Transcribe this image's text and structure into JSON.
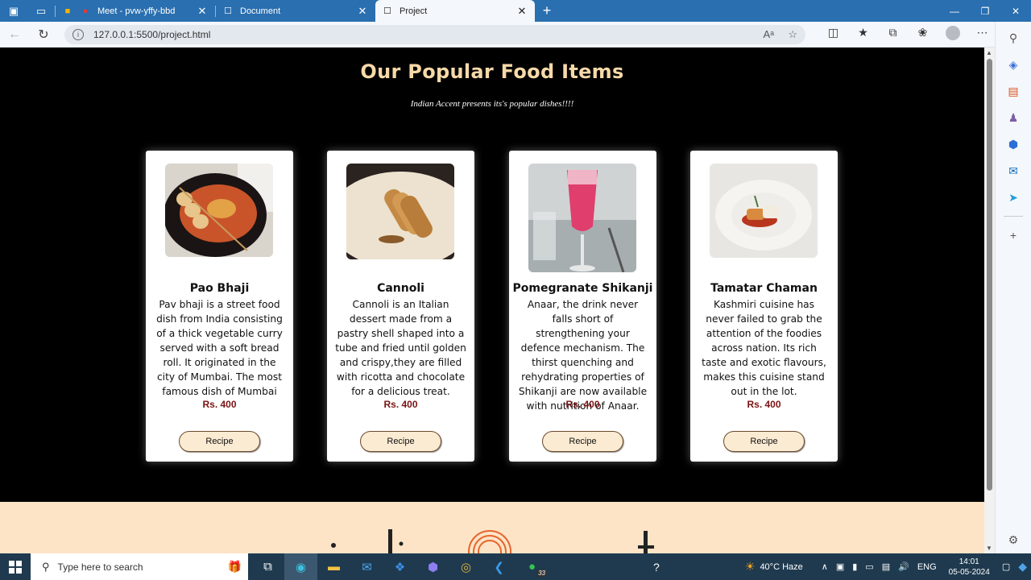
{
  "browser": {
    "tabs": [
      {
        "title": "Meet - pvw-yffy-bbd",
        "active": false
      },
      {
        "title": "Document",
        "active": false
      },
      {
        "title": "Project",
        "active": true
      }
    ],
    "url": "127.0.0.1:5500/project.html",
    "window_controls": [
      "—",
      "❐",
      "✕"
    ]
  },
  "page": {
    "title": "Our Popular Food Items",
    "subtitle": "Indian Accent presents its's popular dishes!!!!",
    "cards": [
      {
        "name": "Pao Bhaji",
        "description": "Pav bhaji is a street food dish from India consisting of a thick vegetable curry served with a soft bread roll. It originated in the city of Mumbai. The most famous dish of Mumbai",
        "price": "Rs. 400",
        "button": "Recipe"
      },
      {
        "name": "Cannoli",
        "description": "Cannoli is an Italian dessert made from a pastry shell shaped into a tube and fried until golden and crispy,they are filled with ricotta and chocolate for a delicious treat.",
        "price": "Rs. 400",
        "button": "Recipe"
      },
      {
        "name": "Pomegranate Shikanji",
        "description": "Anaar, the drink never falls short of strengthening your defence mechanism. The thirst quenching and rehydrating properties of Shikanji are now available with nutrition of Anaar.",
        "price": "Rs. 400",
        "button": "Recipe"
      },
      {
        "name": "Tamatar Chaman",
        "description": "Kashmiri cuisine has never failed to grab the attention of the foodies across nation. Its rich taste and exotic flavours, makes this cuisine stand out in the lot.",
        "price": "Rs. 400",
        "button": "Recipe"
      }
    ]
  },
  "taskbar": {
    "search_placeholder": "Type here to search",
    "whatsapp_badge": "33",
    "weather": "40°C  Haze",
    "language": "ENG",
    "time": "14:01",
    "date": "05-05-2024"
  },
  "colors": {
    "title": "#f7d9a8",
    "price": "#7a1414",
    "button_bg": "#fbebd2",
    "footer_section": "#fde4c7",
    "tab_strip": "#2a6fb0"
  }
}
